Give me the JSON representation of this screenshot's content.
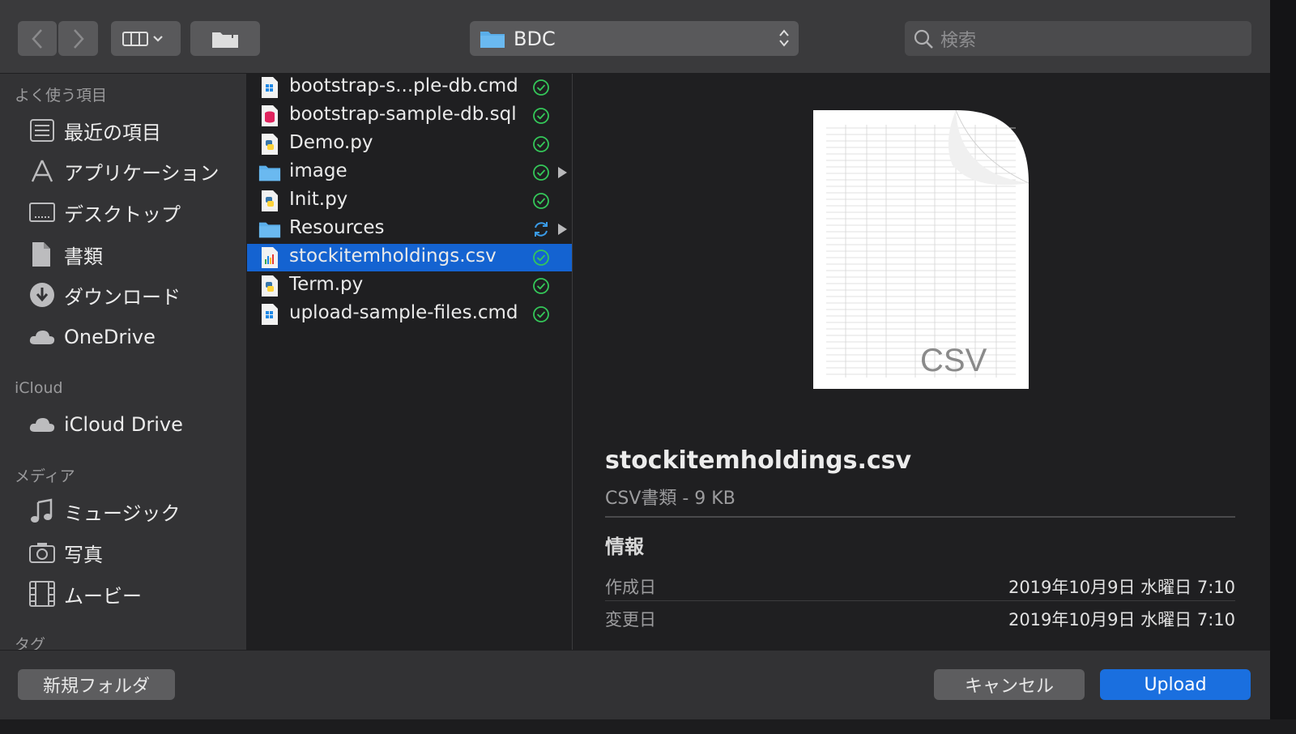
{
  "toolbar": {
    "location": "BDC",
    "search_placeholder": "検索"
  },
  "sidebar": {
    "favorites_label": "よく使う項目",
    "favorites": [
      "最近の項目",
      "アプリケーション",
      "デスクトップ",
      "書類",
      "ダウンロード",
      "OneDrive"
    ],
    "icloud_label": "iCloud",
    "icloud": [
      "iCloud Drive"
    ],
    "media_label": "メディア",
    "media": [
      "ミュージック",
      "写真",
      "ムービー"
    ],
    "tags_label": "タグ"
  },
  "files": [
    {
      "name": "bootstrap-s...ple-db.cmd",
      "icon": "cmd-file-icon",
      "status": "synced"
    },
    {
      "name": "bootstrap-sample-db.sql",
      "icon": "sql-file-icon",
      "status": "synced"
    },
    {
      "name": "Demo.py",
      "icon": "python-file-icon",
      "status": "synced"
    },
    {
      "name": "image",
      "icon": "folder-icon",
      "status": "synced",
      "folder": true
    },
    {
      "name": "Init.py",
      "icon": "python-file-icon",
      "status": "synced"
    },
    {
      "name": "Resources",
      "icon": "folder-icon",
      "status": "syncing",
      "folder": true
    },
    {
      "name": "stockitemholdings.csv",
      "icon": "csv-file-icon",
      "status": "synced",
      "selected": true
    },
    {
      "name": "Term.py",
      "icon": "python-file-icon",
      "status": "synced"
    },
    {
      "name": "upload-sample-files.cmd",
      "icon": "cmd-file-icon",
      "status": "synced"
    }
  ],
  "preview": {
    "thumb_label": "CSV",
    "name": "stockitemholdings.csv",
    "kind": "CSV書類 - 9 KB",
    "info_heading": "情報",
    "created_label": "作成日",
    "created_value": "2019年10月9日 水曜日 7:10",
    "modified_label": "変更日",
    "modified_value": "2019年10月9日 水曜日 7:10"
  },
  "footer": {
    "new_folder": "新規フォルダ",
    "cancel": "キャンセル",
    "upload": "Upload"
  },
  "colors": {
    "accent": "#1463d1",
    "sync_ok": "#34c759",
    "syncing": "#3a9be8"
  }
}
